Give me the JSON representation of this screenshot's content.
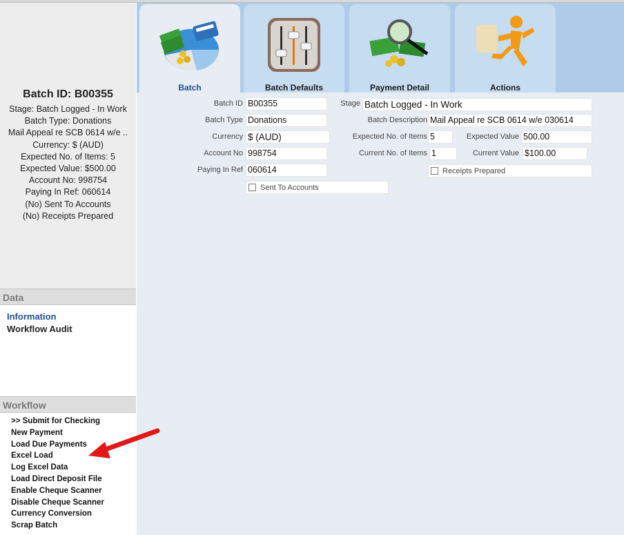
{
  "summary": {
    "batch_id_heading": "Batch ID: B00355",
    "stage": "Stage: Batch Logged - In Work",
    "batch_type": "Batch Type: Donations",
    "description": "Mail Appeal re SCB 0614 w/e ..",
    "currency": "Currency: $ (AUD)",
    "expected_items": "Expected No. of Items: 5",
    "expected_value": "Expected Value: $500.00",
    "account_no": "Account No: 998754",
    "paying_in_ref": "Paying In Ref: 060614",
    "sent_to_accounts": "(No) Sent To Accounts",
    "receipts_prepared": "(No) Receipts Prepared"
  },
  "data_section": {
    "title": "Data",
    "items": [
      "Information",
      "Workflow Audit"
    ]
  },
  "workflow_section": {
    "title": "Workflow",
    "items": [
      ">> Submit for Checking",
      "New Payment",
      "Load Due Payments",
      "Excel Load",
      "Log Excel Data",
      "Load Direct Deposit File",
      "Enable Cheque Scanner",
      "Disable Cheque Scanner",
      "Currency Conversion",
      "Scrap Batch"
    ]
  },
  "tabs": [
    {
      "label": "Batch",
      "icon": "money-pie-card-icon",
      "active": true
    },
    {
      "label": "Batch Defaults",
      "icon": "sliders-icon",
      "active": false
    },
    {
      "label": "Payment Detail",
      "icon": "money-magnifier-icon",
      "active": false
    },
    {
      "label": "Actions",
      "icon": "running-man-icon",
      "active": false
    }
  ],
  "form": {
    "batch_id": {
      "label": "Batch ID",
      "value": "B00355"
    },
    "batch_type": {
      "label": "Batch Type",
      "value": "Donations"
    },
    "currency": {
      "label": "Currency",
      "value": "$ (AUD)"
    },
    "account_no": {
      "label": "Account No",
      "value": "998754"
    },
    "paying_in_ref": {
      "label": "Paying In Ref",
      "value": "060614"
    },
    "sent_to_accounts": {
      "label": "Sent To Accounts",
      "checked": false
    },
    "stage": {
      "label": "Stage",
      "value": "Batch Logged - In Work"
    },
    "batch_description": {
      "label": "Batch Description",
      "value": "Mail Appeal re SCB 0614 w/e 030614"
    },
    "expected_items": {
      "label": "Expected No. of Items",
      "value": "5"
    },
    "expected_value": {
      "label": "Expected Value",
      "value": "500.00"
    },
    "current_items": {
      "label": "Current No. of Items",
      "value": "1"
    },
    "current_value": {
      "label": "Current Value",
      "value": "$100.00"
    },
    "receipts_prepared": {
      "label": "Receipts Prepared",
      "checked": false
    }
  },
  "colors": {
    "tab_bar": "#aecce8",
    "active_tab_label": "#1f4e8c",
    "info_link": "#1f4e8c",
    "annotation_arrow": "#e01818"
  }
}
